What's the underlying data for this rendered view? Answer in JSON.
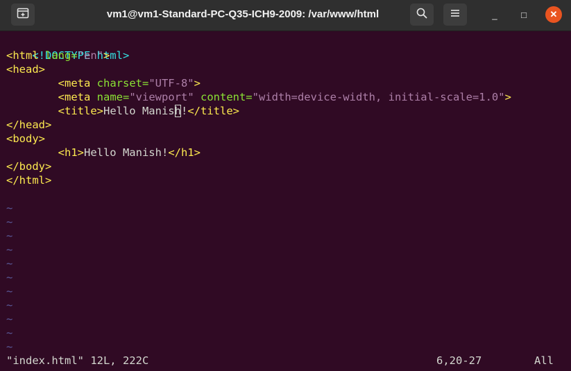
{
  "window": {
    "title": "vm1@vm1-Standard-PC-Q35-ICH9-2009: /var/www/html",
    "icons": {
      "new_tab": "new-tab-icon",
      "search": "search-icon",
      "menu": "hamburger-menu-icon",
      "minimize": "minimize-icon",
      "maximize": "maximize-icon",
      "close": "close-icon"
    },
    "controls": {
      "minimize": "_",
      "maximize": "□",
      "close": "✕"
    }
  },
  "editor": {
    "lines": [
      {
        "parts": [
          "<!DOCTYPE html>"
        ]
      },
      {
        "parts": [
          "<html ",
          "lang=",
          "\"en\"",
          ">"
        ]
      },
      {
        "parts": [
          "<head>"
        ]
      },
      {
        "parts": [
          "        ",
          "<meta ",
          "charset=",
          "\"UTF-8\"",
          ">"
        ]
      },
      {
        "parts": [
          "        ",
          "<meta ",
          "name=",
          "\"viewport\"",
          " content=",
          "\"width=device-width, initial-scale=1.0\"",
          ">"
        ]
      },
      {
        "parts": [
          "        ",
          "<title>",
          "Hello Manis",
          "h",
          "!",
          "</title>"
        ]
      },
      {
        "parts": [
          "</head>"
        ]
      },
      {
        "parts": [
          "<body>"
        ]
      },
      {
        "parts": [
          "        ",
          "<h1>",
          "Hello Manish!",
          "</h1>"
        ]
      },
      {
        "parts": [
          "</body>"
        ]
      },
      {
        "parts": [
          "</html>"
        ]
      }
    ],
    "tilde": "~",
    "colors": {
      "background": "#300a24",
      "tag": "#34e2e2",
      "attribute": "#8ae234",
      "string": "#ad7fa8",
      "text": "#d3d7cf"
    }
  },
  "status": {
    "file_info": "\"index.html\" 12L, 222C",
    "position": "6,20-27",
    "scroll": "All"
  }
}
